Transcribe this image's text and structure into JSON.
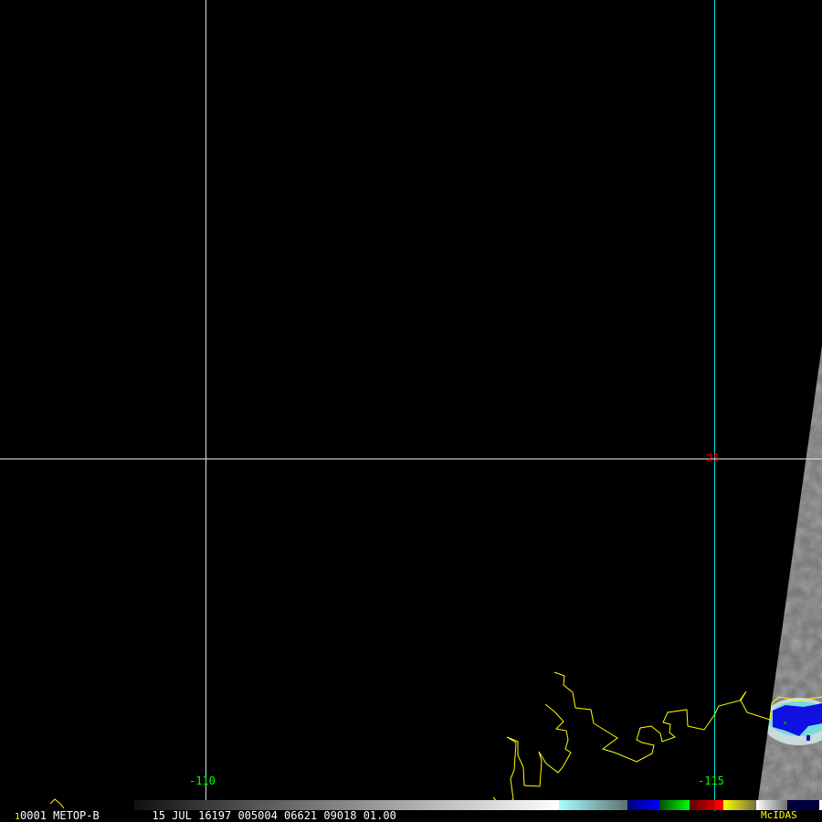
{
  "image": {
    "grid": {
      "longitudes": [
        {
          "label": "-110",
          "color": "#00ff00"
        },
        {
          "label": "-115",
          "color": "#00ff00"
        }
      ],
      "latitudes": [
        {
          "label": "25",
          "color": "#ff0000"
        }
      ]
    },
    "footer": {
      "frame_number": "1",
      "info_text": "0001 METOP-B        15 JUL 16197 005004 06621 09018 01.00",
      "brand": "McIDAS"
    },
    "colors": {
      "coastline": "#ffff00",
      "grid_left": "#d0e8e8",
      "grid_right": "#00e8e8",
      "text": "#ffffff",
      "brand": "#ffff00"
    }
  }
}
